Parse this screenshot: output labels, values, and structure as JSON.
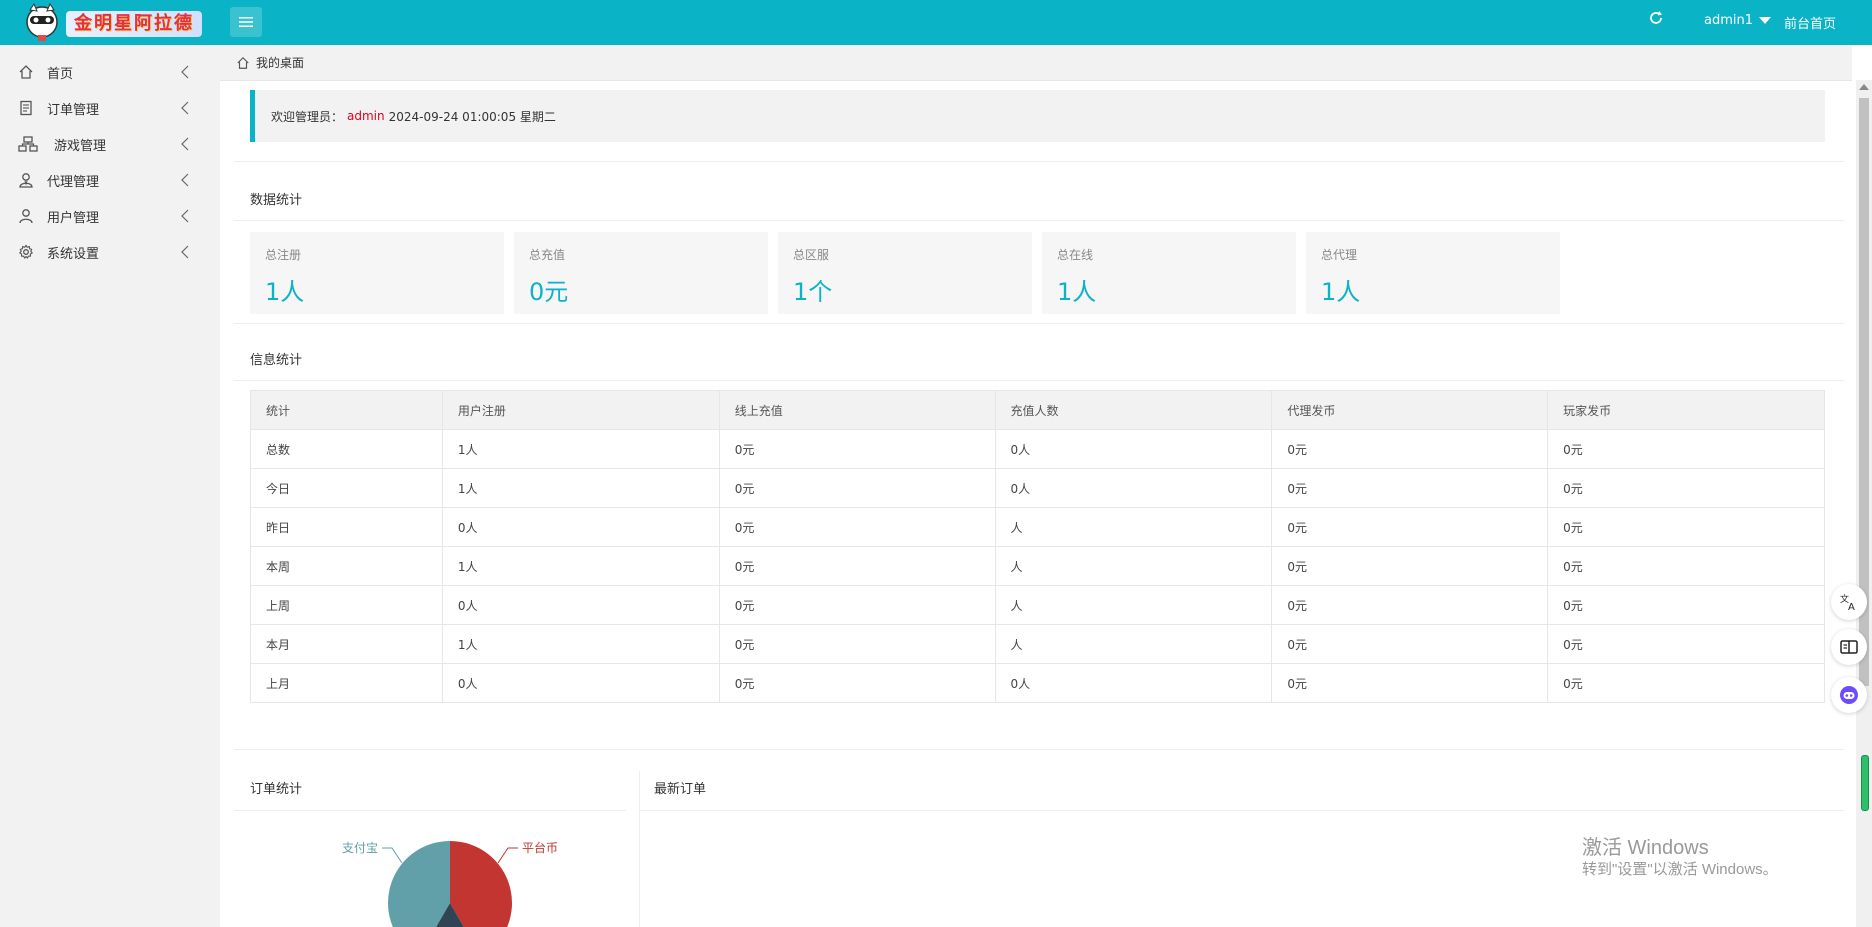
{
  "header": {
    "logo_text": "金明星阿拉德",
    "user": "admin1",
    "front_link": "前台首页"
  },
  "sidebar": {
    "items": [
      {
        "label": "首页",
        "icon": "home-icon"
      },
      {
        "label": "订单管理",
        "icon": "document-icon"
      },
      {
        "label": "游戏管理",
        "icon": "sitemap-icon"
      },
      {
        "label": "代理管理",
        "icon": "agent-icon"
      },
      {
        "label": "用户管理",
        "icon": "user-icon"
      },
      {
        "label": "系统设置",
        "icon": "gear-icon"
      }
    ]
  },
  "breadcrumb": {
    "label": "我的桌面"
  },
  "welcome": {
    "prefix": "欢迎管理员：",
    "admin": "admin",
    "datetime": "2024-09-24  01:00:05  星期二"
  },
  "stats_section": {
    "title": "数据统计",
    "cards": [
      {
        "label": "总注册",
        "value": "1人"
      },
      {
        "label": "总充值",
        "value": "0元"
      },
      {
        "label": "总区服",
        "value": "1个"
      },
      {
        "label": "总在线",
        "value": "1人"
      },
      {
        "label": "总代理",
        "value": "1人"
      }
    ]
  },
  "info_section": {
    "title": "信息统计",
    "columns": [
      "统计",
      "用户注册",
      "线上充值",
      "充值人数",
      "代理发币",
      "玩家发币"
    ],
    "rows": [
      [
        "总数",
        "1人",
        "0元",
        "0人",
        "0元",
        "0元"
      ],
      [
        "今日",
        "1人",
        "0元",
        "0人",
        "0元",
        "0元"
      ],
      [
        "昨日",
        "0人",
        "0元",
        "人",
        "0元",
        "0元"
      ],
      [
        "本周",
        "1人",
        "0元",
        "人",
        "0元",
        "0元"
      ],
      [
        "上周",
        "0人",
        "0元",
        "人",
        "0元",
        "0元"
      ],
      [
        "本月",
        "1人",
        "0元",
        "人",
        "0元",
        "0元"
      ],
      [
        "上月",
        "0人",
        "0元",
        "0人",
        "0元",
        "0元"
      ]
    ]
  },
  "order_section": {
    "title": "订单统计"
  },
  "latest_section": {
    "title": "最新订单"
  },
  "chart_data": {
    "type": "pie",
    "slices": [
      {
        "name": "平台币",
        "color": "#c23531"
      },
      {
        "name": "支付宝",
        "color": "#61a0a8"
      },
      {
        "name": "",
        "color": "#2f4554"
      }
    ]
  },
  "watermark": {
    "line1": "激活 Windows",
    "line2": "转到\"设置\"以激活 Windows。"
  },
  "colors": {
    "accent": "#0ab3c6",
    "admin_highlight": "#e0001e"
  }
}
